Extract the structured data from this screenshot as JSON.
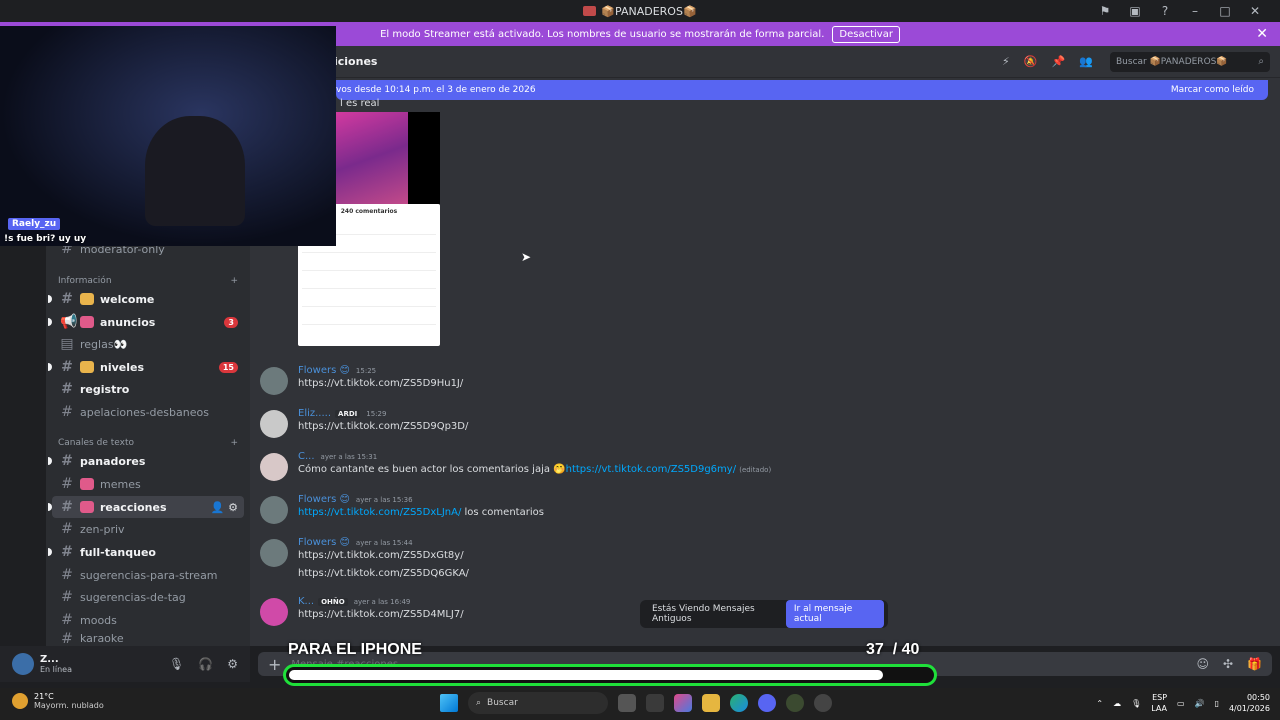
{
  "window": {
    "title": "📦PANADEROS📦"
  },
  "banner": {
    "text": "El modo Streamer está activado. Los nombres de usuario se mostrarán de forma parcial.",
    "button": "Desactivar"
  },
  "header": {
    "channel": "iciones",
    "search_placeholder": "Buscar 📦PANADEROS📦"
  },
  "newbar": {
    "text": "vos desde 10:14 p.m. el 3 de enero de 2026",
    "action": "Marcar como leído"
  },
  "sidebar": {
    "items": [
      {
        "label": "reglas",
        "top": 0
      },
      {
        "label": "moderator-only"
      },
      {
        "label": "welcome"
      },
      {
        "label": "anuncios",
        "badge": "3"
      },
      {
        "label": "reglas👀"
      },
      {
        "label": "niveles",
        "badge": "15"
      },
      {
        "label": "registro"
      },
      {
        "label": "apelaciones-desbaneos"
      },
      {
        "label": "panadores"
      },
      {
        "label": "memes"
      },
      {
        "label": "reacciones"
      },
      {
        "label": "zen-priv"
      },
      {
        "label": "full-tanqueo"
      },
      {
        "label": "sugerencias-para-stream"
      },
      {
        "label": "sugerencias-de-tag"
      },
      {
        "label": "moods"
      },
      {
        "label": "karaoke"
      }
    ],
    "categories": [
      "Información",
      "Canales de texto"
    ]
  },
  "user": {
    "name": "Z...",
    "status": "En línea"
  },
  "webcam": {
    "tag": "Raely_zu",
    "chat": "!s fue bri? uy uy"
  },
  "media": {
    "caption": "l es real",
    "comments_title": "240 comentarios"
  },
  "messages": [
    {
      "name": "Flowers",
      "time": "15:25",
      "text": "https://vt.tiktok.com/ZS5D9Hu1J/"
    },
    {
      "name": "Eliz.....",
      "role": "ARDI",
      "time": "15:29",
      "text": "https://vt.tiktok.com/ZS5D9Qp3D/"
    },
    {
      "name": "C...",
      "time": "ayer a las 15:31",
      "text_pre": "Cómo cantante es buen actor los comentarios jaja 🤭",
      "link": "https://vt.tiktok.com/ZS5D9g6my/",
      "edited": "(editado)"
    },
    {
      "name": "Flowers",
      "time": "ayer a las 15:36",
      "link": "https://vt.tiktok.com/ZS5DxLJnA/",
      "text_post": " los comentarios"
    },
    {
      "name": "Flowers",
      "time": "ayer a las 15:44",
      "text": "https://vt.tiktok.com/ZS5DxGt8y/",
      "text2": "https://vt.tiktok.com/ZS5DQ6GKA/"
    },
    {
      "name": "K...",
      "role": "OHÑO",
      "time": "ayer a las 16:49",
      "text": "https://vt.tiktok.com/ZS5D4MLJ7/"
    }
  ],
  "oldpill": {
    "text": "Estás Viendo Mensajes Antiguos",
    "button": "Ir al mensaje actual"
  },
  "composer": {
    "placeholder": "Mensaje #reacciones"
  },
  "overlay": {
    "title": "PARA EL IPHONE",
    "current": "37",
    "total": "/ 40",
    "progress": 0.925
  },
  "taskbar": {
    "weather_temp": "21°C",
    "weather_desc": "Mayorm. nublado",
    "search": "Buscar",
    "lang1": "ESP",
    "lang2": "LAA",
    "time": "00:50",
    "date": "4/01/2026"
  }
}
